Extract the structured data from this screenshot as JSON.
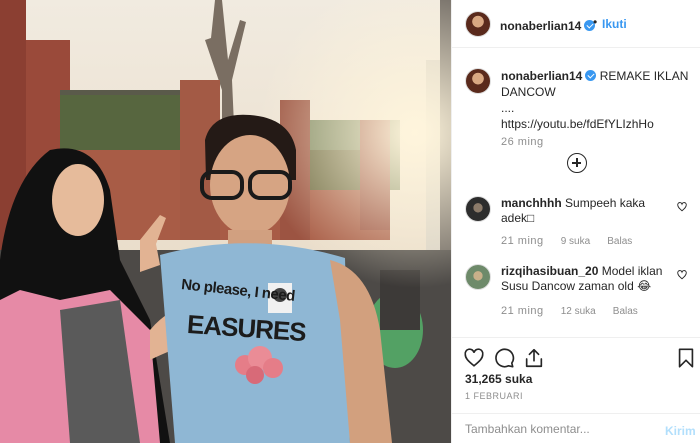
{
  "post": {
    "username": "nonaberlian14",
    "follow_label": "Ikuti",
    "separator": "•"
  },
  "caption": {
    "username": "nonaberlian14",
    "text_line1": "REMAKE IKLAN DANCOW",
    "text_line2": "....",
    "link": "https://youtu.be/fdEfYLIzhHo",
    "time": "26 ming"
  },
  "photo": {
    "shirt_text_line1": "No please, I need",
    "shirt_text_line2": "EASURES"
  },
  "comments": [
    {
      "username": "manchhhh",
      "text": "Sumpeeh kaka adek□",
      "time": "21 ming",
      "likes": "9 suka",
      "reply": "Balas"
    },
    {
      "username": "rizqihasibuan_20",
      "text": "Model iklan Susu Dancow zaman old 😂",
      "time": "21 ming",
      "likes": "12 suka",
      "reply": "Balas"
    }
  ],
  "stats": {
    "likes": "31,265 suka",
    "date": "1 FEBRUARI"
  },
  "composer": {
    "placeholder": "Tambahkan komentar...",
    "post_label": "Kirim"
  },
  "icons": [
    "verified-badge-icon",
    "load-more-comments-icon",
    "heart-icon",
    "comment-icon",
    "share-icon",
    "bookmark-icon"
  ],
  "colors": {
    "accent": "#3897f0",
    "secondary_text": "#8e8e8e",
    "primary_text": "#262626",
    "post_disabled": "#b2dffc"
  }
}
